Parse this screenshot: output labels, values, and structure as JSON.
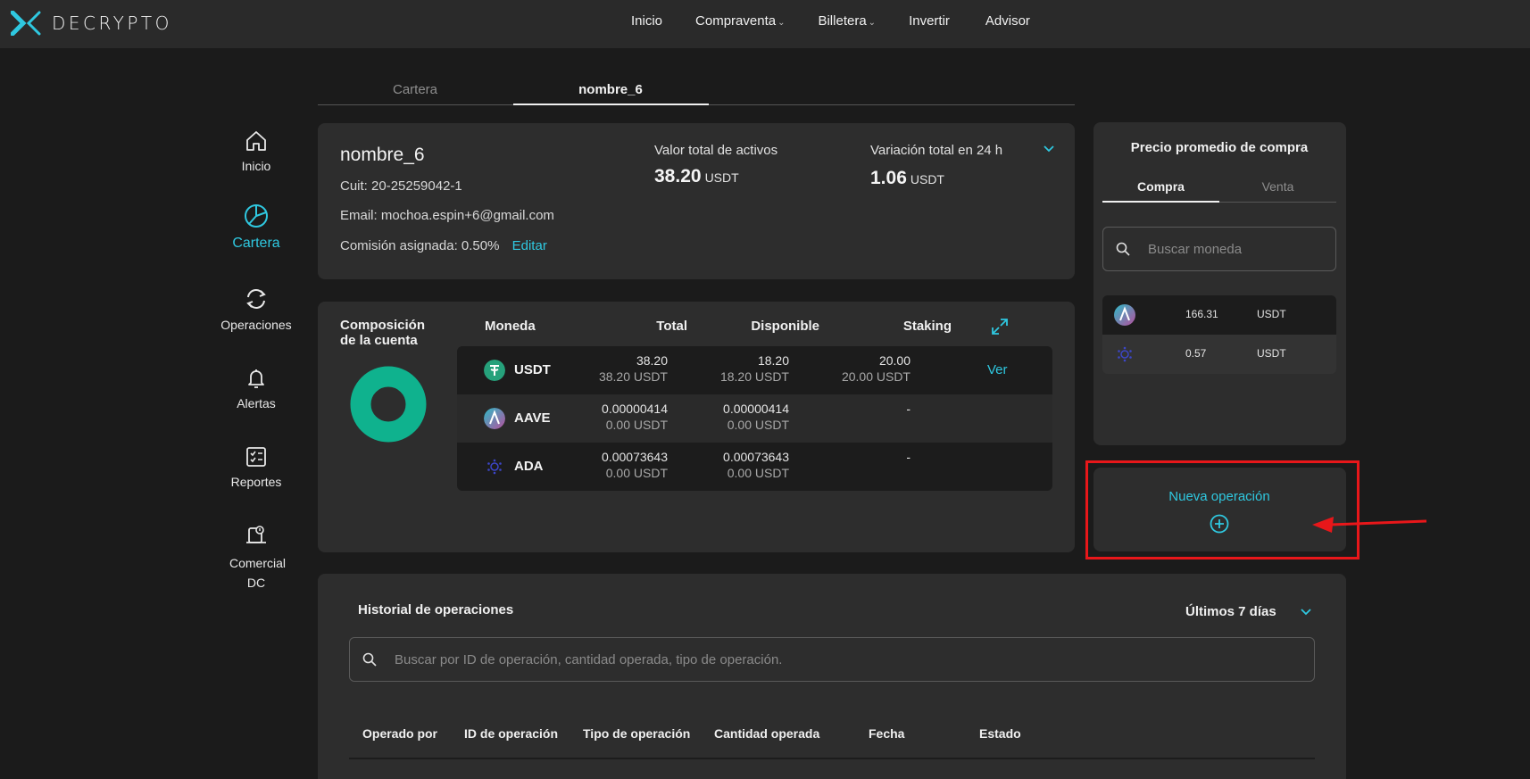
{
  "brand": {
    "name": "DECRYPTO",
    "accent": "#2fc8e0"
  },
  "topnav": [
    {
      "label": "Inicio",
      "dropdown": false
    },
    {
      "label": "Compraventa",
      "dropdown": true
    },
    {
      "label": "Billetera",
      "dropdown": true
    },
    {
      "label": "Invertir",
      "dropdown": false
    },
    {
      "label": "Advisor",
      "dropdown": false
    }
  ],
  "sidebar": [
    {
      "label": "Inicio",
      "icon": "home-icon",
      "active": false
    },
    {
      "label": "Cartera",
      "icon": "pie-chart-icon",
      "active": true
    },
    {
      "label": "Operaciones",
      "icon": "exchange-icon",
      "active": false
    },
    {
      "label": "Alertas",
      "icon": "bell-icon",
      "active": false
    },
    {
      "label": "Reportes",
      "icon": "report-checklist-icon",
      "active": false
    },
    {
      "label": "Comercial DC",
      "icon": "commercial-icon",
      "active": false
    }
  ],
  "tabs": [
    {
      "label": "Cartera",
      "active": false
    },
    {
      "label": "nombre_6",
      "active": true
    }
  ],
  "account": {
    "name": "nombre_6",
    "cuit": "Cuit: 20-25259042-1",
    "email": "Email: mochoa.espin+6@gmail.com",
    "commission": "Comisión asignada: 0.50%",
    "edit_label": "Editar",
    "total_label": "Valor total de activos",
    "total_value": "38.20",
    "total_unit": "USDT",
    "variation_label": "Variación total en 24 h",
    "variation_value": "1.06",
    "variation_unit": "USDT"
  },
  "composition": {
    "title": "Composición de la cuenta",
    "donut_color": "#0fb28e",
    "columns": [
      "Moneda",
      "Total",
      "Disponible",
      "Staking"
    ],
    "action_label": "Ver",
    "rows": [
      {
        "coin": "USDT",
        "icon": "tether-icon",
        "total": "38.20",
        "total_usdt": "38.20 USDT",
        "available": "18.20",
        "available_usdt": "18.20 USDT",
        "staking": "20.00",
        "staking_usdt": "20.00 USDT"
      },
      {
        "coin": "AAVE",
        "icon": "aave-icon",
        "total": "0.00000414",
        "total_usdt": "0.00 USDT",
        "available": "0.00000414",
        "available_usdt": "0.00 USDT",
        "staking": "-",
        "staking_usdt": ""
      },
      {
        "coin": "ADA",
        "icon": "cardano-icon",
        "total": "0.00073643",
        "total_usdt": "0.00 USDT",
        "available": "0.00073643",
        "available_usdt": "0.00 USDT",
        "staking": "-",
        "staking_usdt": ""
      }
    ]
  },
  "avg_price": {
    "title": "Precio promedio de compra",
    "tabs": [
      "Compra",
      "Venta"
    ],
    "search_placeholder": "Buscar moneda",
    "rows": [
      {
        "icon": "aave-icon",
        "value": "166.31",
        "unit": "USDT"
      },
      {
        "icon": "cardano-icon",
        "value": "0.57",
        "unit": "USDT"
      }
    ]
  },
  "new_operation": {
    "label": "Nueva operación"
  },
  "history": {
    "title": "Historial de operaciones",
    "range": "Últimos 7 días",
    "search_placeholder": "Buscar por ID de operación, cantidad operada, tipo de operación.",
    "columns": [
      "Operado por",
      "ID de operación",
      "Tipo de operación",
      "Cantidad operada",
      "Fecha",
      "Estado"
    ]
  }
}
